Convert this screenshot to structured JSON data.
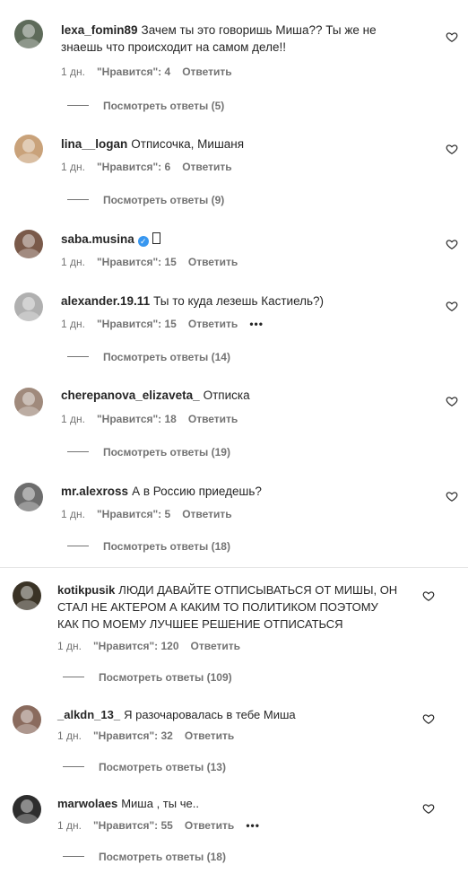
{
  "comments": [
    {
      "user": "lexa_fomin89",
      "text": "Зачем ты это говоришь Миша?? Ты же не знаешь что происходит на самом деле!!",
      "text_line1": "Зачем ты это говоришь Миша?? Ты же не",
      "text_line2": "знаешь что происходит на самом деле!!",
      "time": "1 дн.",
      "likes": "\"Нравится\": 4",
      "reply": "Ответить",
      "view_replies": "Посмотреть ответы (5)"
    },
    {
      "user": "lina__logan",
      "text": "Отписочка, Мишаня",
      "time": "1 дн.",
      "likes": "\"Нравится\": 6",
      "reply": "Ответить",
      "view_replies": "Посмотреть ответы (9)"
    },
    {
      "user": "saba.musina",
      "text": "",
      "time": "1 дн.",
      "likes": "\"Нравится\": 15",
      "reply": "Ответить"
    },
    {
      "user": "alexander.19.11",
      "text": "Ты то куда лезешь Кастиель?)",
      "time": "1 дн.",
      "likes": "\"Нравится\": 15",
      "reply": "Ответить",
      "more": "•••",
      "view_replies": "Посмотреть ответы (14)"
    },
    {
      "user": "cherepanova_elizaveta_",
      "text": "Отписка",
      "time": "1 дн.",
      "likes": "\"Нравится\": 18",
      "reply": "Ответить",
      "view_replies": "Посмотреть ответы (19)"
    },
    {
      "user": "mr.alexross",
      "text": "А в Россию приедешь?",
      "time": "1 дн.",
      "likes": "\"Нравится\": 5",
      "reply": "Ответить",
      "view_replies": "Посмотреть ответы (18)"
    },
    {
      "user": "kotikpusik",
      "text_line1": "ЛЮДИ ДАВАЙТЕ ОТПИСЫВАТЬСЯ ОТ МИШЫ, ОН",
      "text_line2": "СТАЛ НЕ АКТЕРОМ А КАКИМ ТО ПОЛИТИКОМ ПОЭТОМУ",
      "text_line3": "КАК ПО МОЕМУ ЛУЧШЕЕ РЕШЕНИЕ ОТПИСАТЬСЯ",
      "time": "1 дн.",
      "likes": "\"Нравится\": 120",
      "reply": "Ответить",
      "view_replies": "Посмотреть ответы (109)"
    },
    {
      "user": "_alkdn_13_",
      "text": "Я разочаровалась в тебе Миша",
      "time": "1 дн.",
      "likes": "\"Нравится\": 32",
      "reply": "Ответить",
      "view_replies": "Посмотреть ответы (13)"
    },
    {
      "user": "marwolaes",
      "text": "Миша , ты че..",
      "time": "1 дн.",
      "likes": "\"Нравится\": 55",
      "reply": "Ответить",
      "more": "•••",
      "view_replies": "Посмотреть ответы (18)"
    }
  ],
  "colors": {
    "text": "#262626",
    "secondary": "#737373",
    "verified": "#3897f0"
  },
  "icons": {
    "like": "heart-outline-icon",
    "verified": "verified-badge-icon"
  }
}
